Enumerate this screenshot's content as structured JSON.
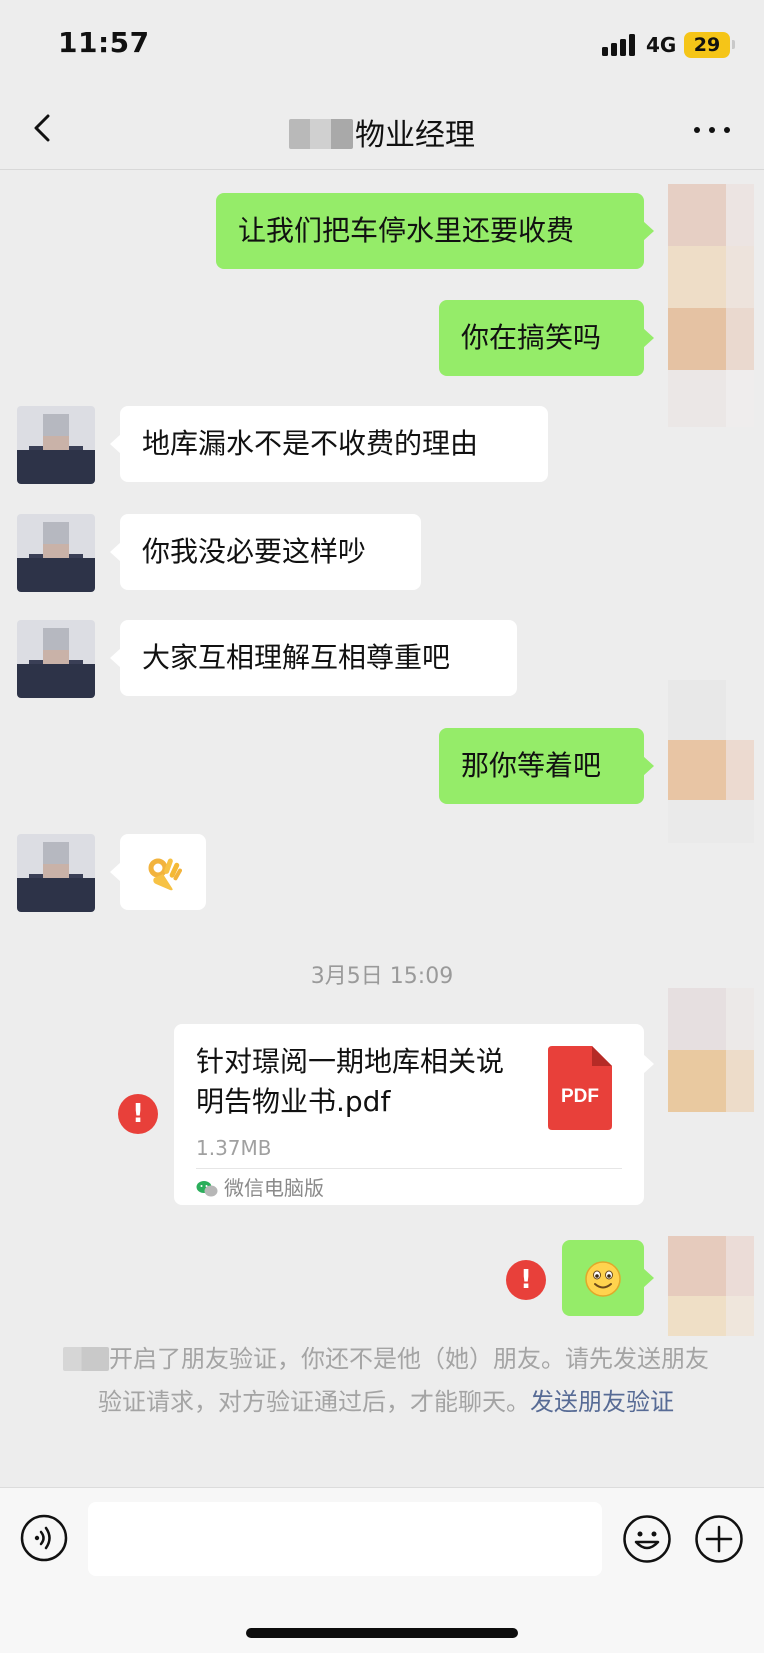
{
  "status_bar": {
    "time": "11:57",
    "network": "4G",
    "battery": "29"
  },
  "nav": {
    "title": "物业经理",
    "back_icon": "chevron-left-icon",
    "more_icon": "more-dots-icon"
  },
  "messages": [
    {
      "side": "out",
      "text": "让我们把车停水里还要收费"
    },
    {
      "side": "out",
      "text": "你在搞笑吗"
    },
    {
      "side": "in",
      "text": "地库漏水不是不收费的理由"
    },
    {
      "side": "in",
      "text": "你我没必要这样吵"
    },
    {
      "side": "in",
      "text": "大家互相理解互相尊重吧"
    },
    {
      "side": "out",
      "text": "那你等着吧"
    },
    {
      "side": "in",
      "emoji": "ok-hand-emoji"
    }
  ],
  "timestamp": "3月5日 15:09",
  "file": {
    "name": "针对璟阅一期地库相关说明告物业书.pdf",
    "size": "1.37MB",
    "type_label": "PDF",
    "source": "微信电脑版",
    "status": "send-failed"
  },
  "last_message": {
    "side": "out",
    "emoji": "smiling-face-emoji",
    "status": "send-failed"
  },
  "notice": {
    "text": "开启了朋友验证，你还不是他（她）朋友。请先发送朋友验证请求，对方验证通过后，才能聊天。",
    "link": "发送朋友验证"
  },
  "input_bar": {
    "voice_icon": "voice-icon",
    "emoji_icon": "emoji-icon",
    "plus_icon": "plus-icon",
    "placeholder": ""
  },
  "colors": {
    "outgoing_bubble": "#95ec69",
    "incoming_bubble": "#ffffff",
    "background": "#ededed",
    "link": "#576b95",
    "error": "#e8403a",
    "pdf": "#e8403a"
  }
}
